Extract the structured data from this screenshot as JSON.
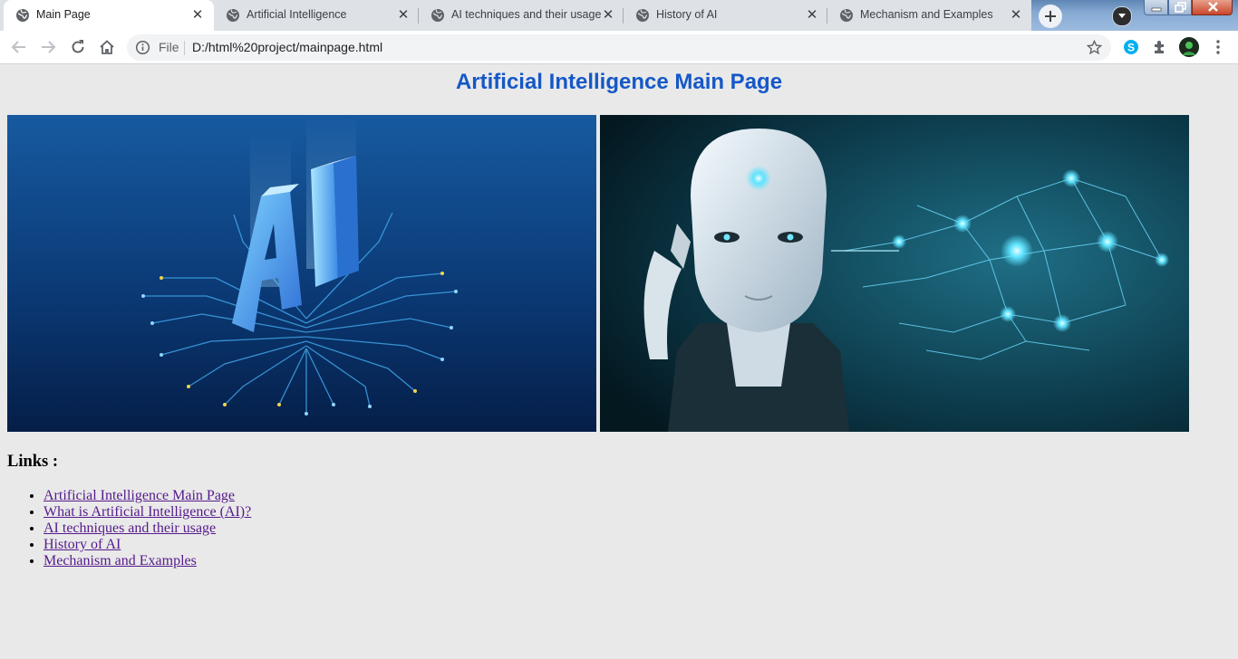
{
  "browser": {
    "tabs": [
      {
        "title": "Main Page",
        "active": true
      },
      {
        "title": "Artificial Intelligence",
        "active": false
      },
      {
        "title": "AI techniques and their usage",
        "active": false
      },
      {
        "title": "History of AI",
        "active": false
      },
      {
        "title": "Mechanism and Examples",
        "active": false
      }
    ],
    "address": {
      "scheme_label": "File",
      "url": "D:/html%20project/mainpage.html"
    },
    "icons": {
      "back": "arrow-left-icon",
      "forward": "arrow-right-icon",
      "reload": "reload-icon",
      "home": "home-icon",
      "info": "info-icon",
      "bookmark": "star-icon",
      "skype": "skype-icon",
      "extensions": "puzzle-icon",
      "menu": "kebab-menu-icon",
      "new_tab": "plus-icon",
      "tab_search": "chevron-down-icon",
      "favicon": "globe-icon"
    }
  },
  "page": {
    "title": "Artificial Intelligence Main Page",
    "images": [
      {
        "name": "ai-circuit-image",
        "description_icon": "ai-chip-illustration"
      },
      {
        "name": "robot-brain-image",
        "description_icon": "robot-brain-illustration"
      }
    ],
    "links_heading": "Links :",
    "links": [
      "Artificial Intelligence Main Page",
      "What is Artificial Intelligence (AI)?",
      "AI techniques and their usage",
      "History of AI",
      "Mechanism and Examples"
    ]
  },
  "colors": {
    "title": "#1558c7",
    "link_visited": "#551a8b",
    "page_background": "#e9e9e9",
    "tabstrip": "#dee1e6"
  }
}
